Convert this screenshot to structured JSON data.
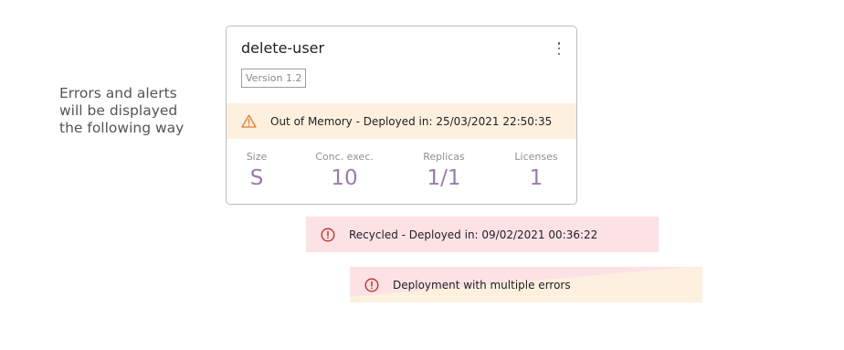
{
  "side_note": {
    "line1": "Errors and alerts",
    "line2": "will be displayed",
    "line3": "the following way"
  },
  "card": {
    "title": "delete-user",
    "version": "Version 1.2",
    "menu_icon": "kebab-menu-icon",
    "alert": {
      "icon": "warning-triangle-icon",
      "text": "Out of Memory - Deployed in: 25/03/2021 22:50:35"
    },
    "stats": [
      {
        "label": "Size",
        "value": "S"
      },
      {
        "label": "Conc. exec.",
        "value": "10"
      },
      {
        "label": "Replicas",
        "value": "1/1"
      },
      {
        "label": "Licenses",
        "value": "1"
      }
    ]
  },
  "alerts": {
    "recycled": {
      "icon": "error-circle-icon",
      "text": "Recycled - Deployed in: 09/02/2021 00:36:22"
    },
    "multiple": {
      "icon": "error-circle-icon",
      "text": "Deployment with multiple errors"
    }
  },
  "colors": {
    "accent_value": "#9a7ab0",
    "warning": "#e8782b",
    "error": "#c62828",
    "warning_bg": "#fdf0df",
    "error_bg": "#fde2e5"
  }
}
